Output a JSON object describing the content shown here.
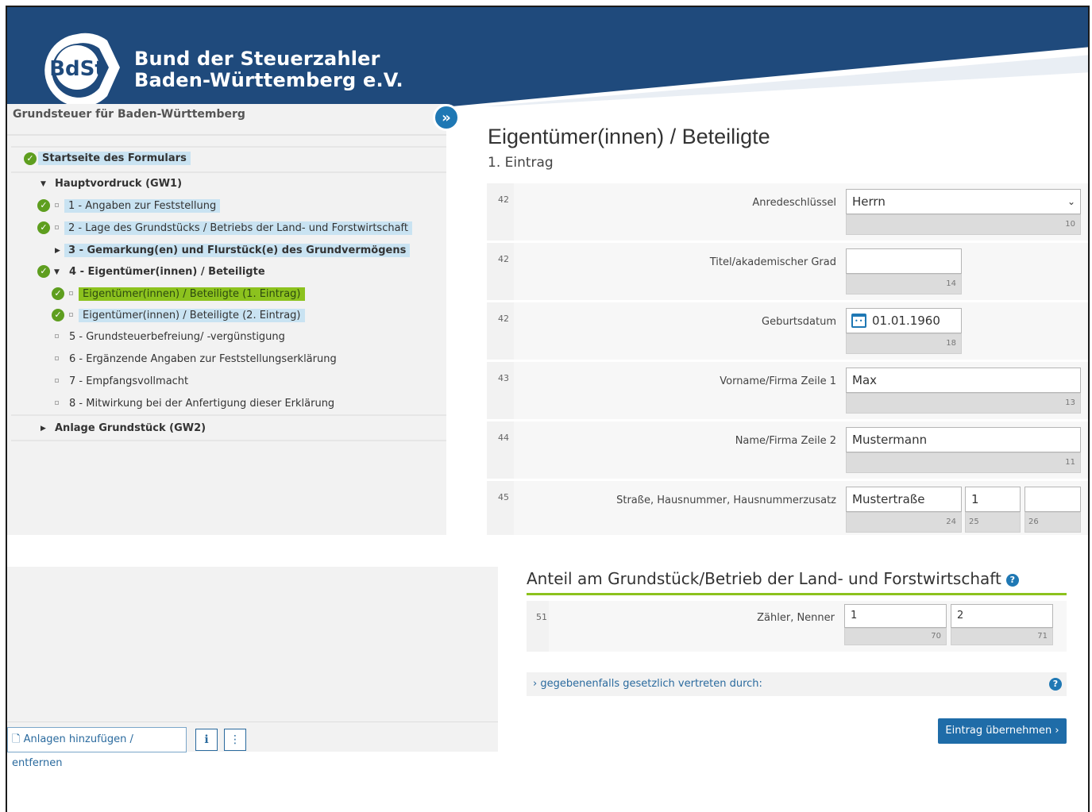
{
  "brand": {
    "line1": "Bund der Steuerzahler",
    "line2": "Baden-Württemberg e.V.",
    "logo_text": "BdSt"
  },
  "left": {
    "title": "Grundsteuer für Baden-Württemberg",
    "tree": {
      "start": "Startseite des Formulars",
      "hauptvordruck": "Hauptvordruck (GW1)",
      "item1": "1 - Angaben zur Feststellung",
      "item2": "2 - Lage des Grundstücks / Betriebs der Land- und Forstwirtschaft",
      "item3": "3 - Gemarkung(en) und Flurstück(e) des Grundvermögens",
      "item4": "4 - Eigentümer(innen) / Beteiligte",
      "item4a": "Eigentümer(innen) / Beteiligte (1. Eintrag)",
      "item4b": "Eigentümer(innen) / Beteiligte (2. Eintrag)",
      "item5": "5 - Grundsteuerbefreiung/ -vergünstigung",
      "item6": "6 - Ergänzende Angaben zur Feststellungserklärung",
      "item7": "7 - Empfangsvollmacht",
      "item8": "8 - Mitwirkung bei der Anfertigung dieser Erklärung",
      "anlage": "Anlage Grundstück (GW2)"
    },
    "add_button": "Anlagen hinzufügen / entfernen"
  },
  "form": {
    "title": "Eigentümer(innen) / Beteiligte",
    "subtitle": "1. Eintrag",
    "rows": [
      {
        "num": "42",
        "label": "Anredeschlüssel",
        "value": "Herrn",
        "count": "10"
      },
      {
        "num": "42",
        "label": "Titel/akademischer Grad",
        "value": "",
        "count": "14"
      },
      {
        "num": "42",
        "label": "Geburtsdatum",
        "value": "01.01.1960",
        "count": "18"
      },
      {
        "num": "43",
        "label": "Vorname/Firma Zeile 1",
        "value": "Max",
        "count": "13"
      },
      {
        "num": "44",
        "label": "Name/Firma Zeile 2",
        "value": "Mustermann",
        "count": "11"
      },
      {
        "num": "45",
        "label": "Straße,  Hausnummer,  Hausnummerzusatz",
        "value": "Mustertraße",
        "count": "24",
        "value2": "1",
        "count2": "25",
        "value3": "",
        "count3": "26"
      }
    ]
  },
  "share": {
    "title": "Anteil am Grundstück/Betrieb der Land- und Forstwirtschaft",
    "help": "?",
    "num": "51",
    "label": "Zähler,  Nenner",
    "zaehler": "1",
    "zaehler_count": "70",
    "nenner": "2",
    "nenner_count": "71",
    "represented": "gegebenenfalls gesetzlich vertreten durch:",
    "submit": "Eintrag übernehmen"
  },
  "colors": {
    "header": "#1f4a7c",
    "accent": "#1f78b4",
    "green": "#8cc21e",
    "highlight": "#c9e3f2"
  },
  "icons": {
    "expand": "double-chevron-right-icon",
    "check": "check-circle-icon",
    "calendar": "calendar-icon",
    "help": "question-circle-icon",
    "file": "file-icon",
    "more": "kebab-icon"
  }
}
